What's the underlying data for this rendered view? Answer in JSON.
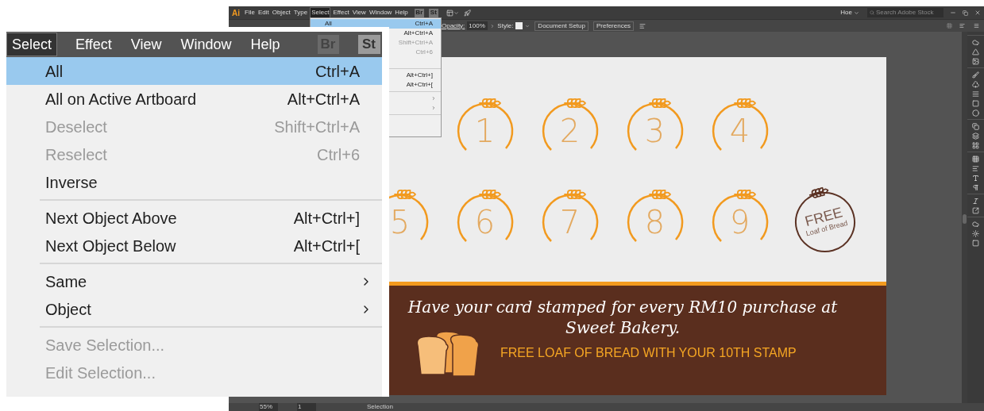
{
  "app": {
    "menubar": {
      "logo": "Ai",
      "menus": [
        {
          "label": "File",
          "selected": false
        },
        {
          "label": "Edit",
          "selected": false
        },
        {
          "label": "Object",
          "selected": false
        },
        {
          "label": "Type",
          "selected": false
        },
        {
          "label": "Select",
          "selected": true
        },
        {
          "label": "Effect",
          "selected": false
        },
        {
          "label": "View",
          "selected": false
        },
        {
          "label": "Window",
          "selected": false
        },
        {
          "label": "Help",
          "selected": false
        }
      ],
      "app_buttons": [
        "Br",
        "St"
      ],
      "workspace": "Hoe",
      "search": {
        "placeholder": "Search Adobe Stock"
      }
    },
    "control_bar": {
      "opacity_label": "Opacity:",
      "opacity": "100%",
      "style_label": "Style:",
      "buttons": [
        "Document Setup",
        "Preferences"
      ]
    },
    "select_menu": {
      "items": [
        {
          "kind": "item",
          "label": "All",
          "shortcut": "Ctrl+A",
          "selected": true,
          "disabled": false,
          "submenu": false
        },
        {
          "kind": "item",
          "shortcut": "Alt+Ctrl+A",
          "selected": false,
          "disabled": false
        },
        {
          "kind": "item",
          "shortcut": "Shift+Ctrl+A",
          "selected": false,
          "disabled": true
        },
        {
          "kind": "item",
          "shortcut": "Ctrl+6",
          "selected": false,
          "disabled": true
        },
        {
          "kind": "item"
        },
        {
          "kind": "separator"
        },
        {
          "kind": "item",
          "shortcut": "Alt+Ctrl+]",
          "selected": false,
          "disabled": false
        },
        {
          "kind": "item",
          "shortcut": "Alt+Ctrl+[",
          "selected": false,
          "disabled": false
        },
        {
          "kind": "separator"
        },
        {
          "kind": "item",
          "selected": false,
          "submenu": true
        },
        {
          "kind": "item",
          "selected": false,
          "submenu": true
        },
        {
          "kind": "separator"
        },
        {
          "kind": "item"
        },
        {
          "kind": "item"
        }
      ]
    },
    "artboard": {
      "stamp_rows": [
        {
          "stamps": [
            {
              "kind": "empty"
            },
            {
              "kind": "number",
              "label": "1"
            },
            {
              "kind": "number",
              "label": "2"
            },
            {
              "kind": "number",
              "label": "3"
            },
            {
              "kind": "number",
              "label": "4"
            }
          ]
        },
        {
          "stamps": [
            {
              "kind": "number",
              "label": "5"
            },
            {
              "kind": "number",
              "label": "6"
            },
            {
              "kind": "number",
              "label": "7"
            },
            {
              "kind": "number",
              "label": "8"
            },
            {
              "kind": "number",
              "label": "9"
            },
            {
              "kind": "reward",
              "title": "FREE",
              "subtitle": "Loaf of Bread"
            }
          ]
        }
      ],
      "message": "Have your card stamped for every RM10 purchase at Sweet Bakery.",
      "offer": "FREE LOAF OF BREAD WITH YOUR 10TH STAMP"
    },
    "status_bar": {
      "zoom": "55%",
      "artboard": "1",
      "tool": "Selection"
    }
  },
  "inset_menu": {
    "menubar": [
      {
        "label": "Select",
        "selected": true
      },
      {
        "label": "Effect",
        "selected": false
      },
      {
        "label": "View",
        "selected": false
      },
      {
        "label": "Window",
        "selected": false
      },
      {
        "label": "Help",
        "selected": false
      }
    ],
    "app_buttons": [
      "Br",
      "St"
    ],
    "items": [
      {
        "kind": "item",
        "label": "All",
        "shortcut": "Ctrl+A",
        "selected": true,
        "disabled": false,
        "submenu": false
      },
      {
        "kind": "item",
        "label": "All on Active Artboard",
        "shortcut": "Alt+Ctrl+A",
        "selected": false,
        "disabled": false,
        "submenu": false
      },
      {
        "kind": "item",
        "label": "Deselect",
        "shortcut": "Shift+Ctrl+A",
        "selected": false,
        "disabled": true,
        "submenu": false
      },
      {
        "kind": "item",
        "label": "Reselect",
        "shortcut": "Ctrl+6",
        "selected": false,
        "disabled": true,
        "submenu": false
      },
      {
        "kind": "item",
        "label": "Inverse",
        "selected": false,
        "disabled": false,
        "submenu": false
      },
      {
        "kind": "separator"
      },
      {
        "kind": "item",
        "label": "Next Object Above",
        "shortcut": "Alt+Ctrl+]",
        "selected": false,
        "disabled": false,
        "submenu": false
      },
      {
        "kind": "item",
        "label": "Next Object Below",
        "shortcut": "Alt+Ctrl+[",
        "selected": false,
        "disabled": false,
        "submenu": false
      },
      {
        "kind": "separator"
      },
      {
        "kind": "item",
        "label": "Same",
        "selected": false,
        "disabled": false,
        "submenu": true
      },
      {
        "kind": "item",
        "label": "Object",
        "selected": false,
        "disabled": false,
        "submenu": true
      },
      {
        "kind": "separator"
      },
      {
        "kind": "item",
        "label": "Save Selection...",
        "selected": false,
        "disabled": true,
        "submenu": false
      },
      {
        "kind": "item",
        "label": "Edit Selection...",
        "selected": false,
        "disabled": true,
        "submenu": false
      }
    ]
  }
}
